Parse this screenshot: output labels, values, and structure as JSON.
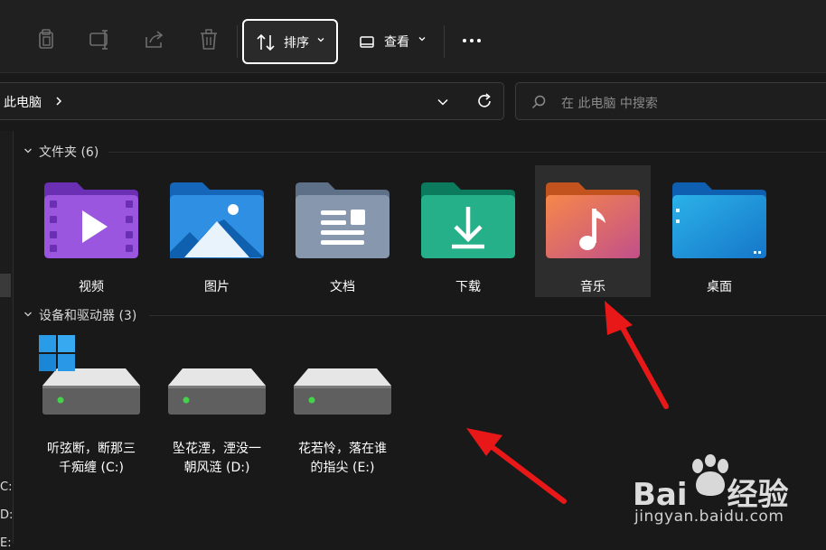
{
  "toolbar": {
    "sort_label": "排序",
    "view_label": "查看"
  },
  "address": {
    "path": "此电脑"
  },
  "search": {
    "placeholder": "在 此电脑 中搜索"
  },
  "nav": {
    "drive_labels": [
      "C:",
      "D:",
      "E:"
    ]
  },
  "groups": {
    "folders": {
      "header": "文件夹 (6)",
      "items": [
        {
          "name": "视频",
          "icon": "videos-folder-icon"
        },
        {
          "name": "图片",
          "icon": "pictures-folder-icon"
        },
        {
          "name": "文档",
          "icon": "documents-folder-icon"
        },
        {
          "name": "下载",
          "icon": "downloads-folder-icon"
        },
        {
          "name": "音乐",
          "icon": "music-folder-icon",
          "selected": true
        },
        {
          "name": "桌面",
          "icon": "desktop-folder-icon"
        }
      ]
    },
    "drives": {
      "header": "设备和驱动器 (3)",
      "items": [
        {
          "line1": "听弦断，断那三",
          "line2": "千痴缠 (C:)",
          "icon": "windows-drive-icon"
        },
        {
          "line1": "坠花湮，湮没一",
          "line2": "朝风涟 (D:)",
          "icon": "hard-drive-icon"
        },
        {
          "line1": "花若怜，落在谁",
          "line2": "的指尖 (E:)",
          "icon": "hard-drive-icon"
        }
      ]
    }
  },
  "watermark": {
    "brand_a": "Bai",
    "brand_b": "经验",
    "url": "jingyan.baidu.com"
  },
  "colors": {
    "background": "#191919",
    "toolbar": "#202020",
    "annotation_arrow": "#e81818",
    "selected_tile": "#2d2d2d"
  }
}
